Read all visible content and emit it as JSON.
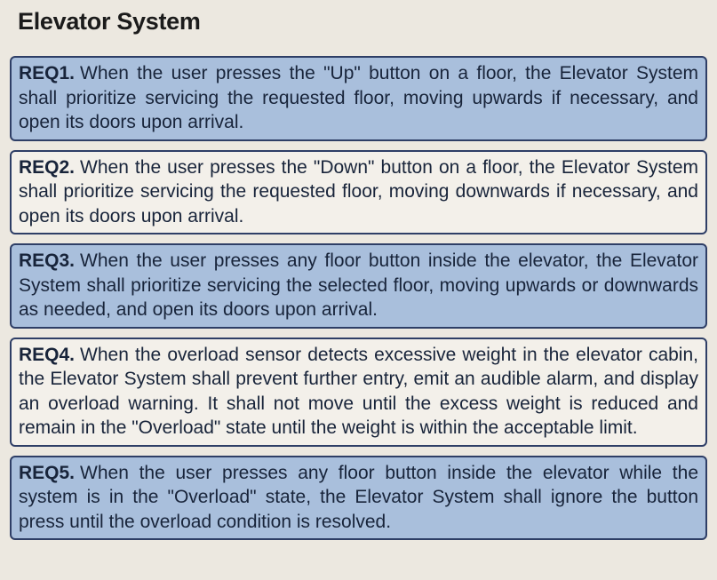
{
  "title": "Elevator System",
  "requirements": [
    {
      "id": "REQ1.",
      "text": "When the user presses the \"Up\" button on a floor, the Elevator System shall prioritize servicing the requested floor, moving upwards if necessary, and open its doors upon arrival.",
      "background": "#a9bfdc"
    },
    {
      "id": "REQ2.",
      "text": "When the user presses the \"Down\" button on a floor, the Elevator System shall prioritize servicing the requested floor, moving downwards if necessary, and open its doors upon arrival.",
      "background": "#f3f0ea"
    },
    {
      "id": "REQ3.",
      "text": "When the user presses any floor button inside the elevator, the Elevator System shall prioritize servicing the selected floor, moving upwards or downwards as needed, and open its doors upon arrival.",
      "background": "#a9bfdc"
    },
    {
      "id": "REQ4.",
      "text": "When the overload sensor detects excessive weight in the elevator cabin, the Elevator System shall prevent further entry, emit an audible alarm, and display an overload warning. It shall not move until the excess weight is reduced and remain in the \"Overload\" state until the weight is within the acceptable limit.",
      "background": "#f3f0ea"
    },
    {
      "id": "REQ5.",
      "text": "When the user presses any floor button inside the elevator while the system is in the \"Overload\" state, the Elevator System shall ignore the button press until the overload condition is resolved.",
      "background": "#a9bfdc"
    }
  ],
  "colors": {
    "page_background": "#ece8e0",
    "border": "#2e3e66",
    "shaded_box": "#a9bfdc",
    "plain_box": "#f3f0ea"
  }
}
